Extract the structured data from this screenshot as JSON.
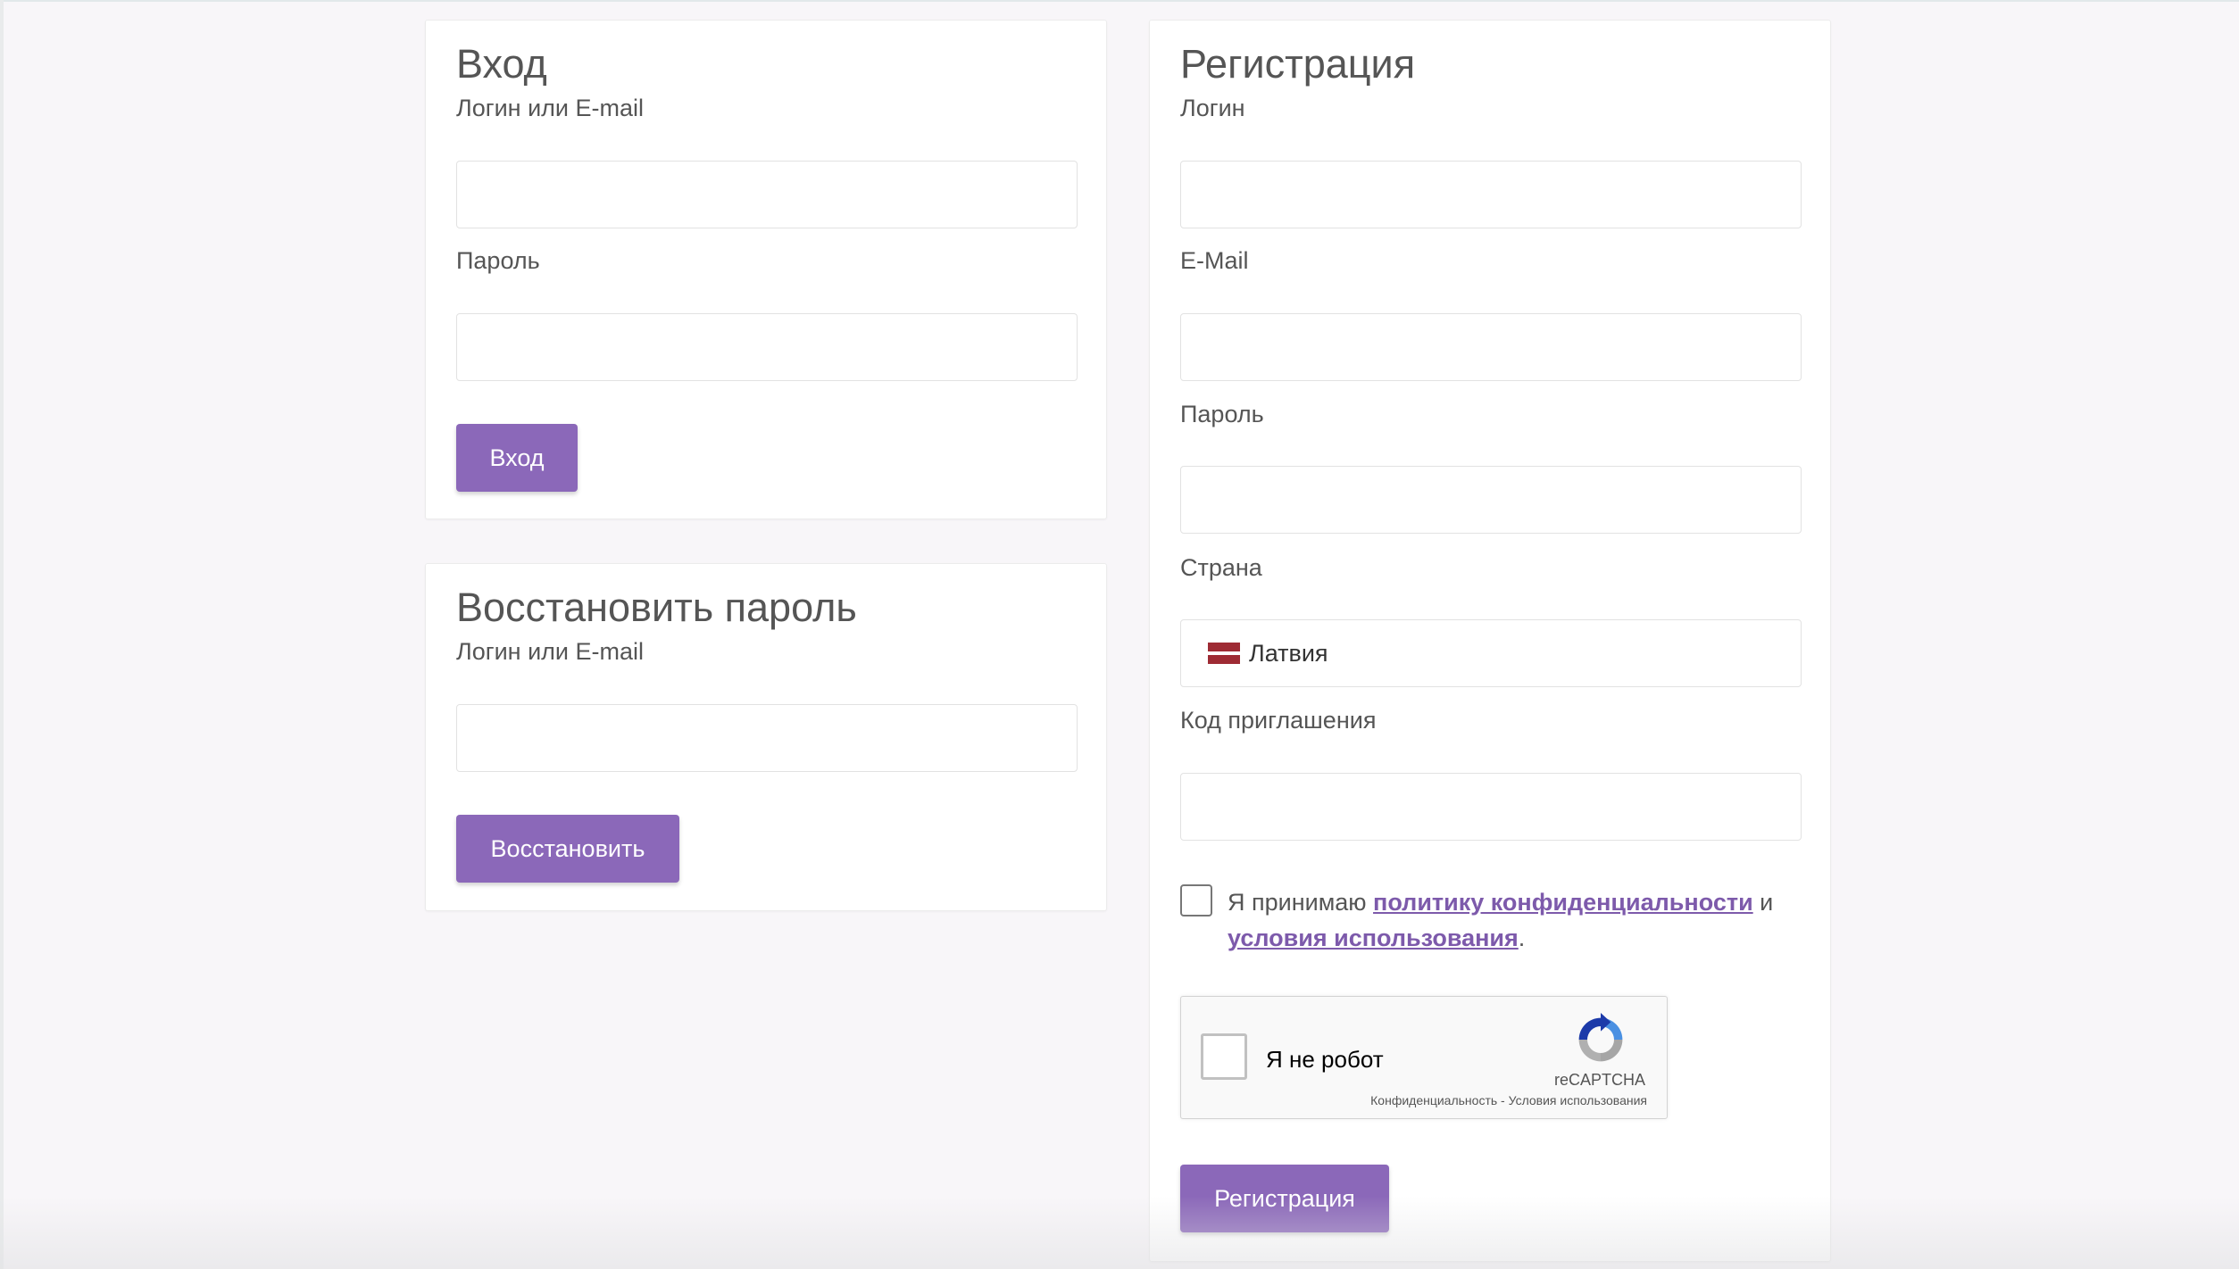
{
  "login": {
    "title": "Вход",
    "login_label": "Логин или E-mail",
    "login_value": "",
    "password_label": "Пароль",
    "password_value": "",
    "button": "Вход"
  },
  "recover": {
    "title": "Восстановить пароль",
    "login_label": "Логин или E-mail",
    "login_value": "",
    "button": "Восстановить"
  },
  "register": {
    "title": "Регистрация",
    "login_label": "Логин",
    "login_value": "",
    "email_label": "E-Mail",
    "email_value": "",
    "password_label": "Пароль",
    "password_value": "",
    "country_label": "Страна",
    "country_value": "Латвия",
    "country_flag_icon": "latvia-flag-icon",
    "invite_label": "Код приглашения",
    "invite_value": "",
    "agree": {
      "prefix": "Я принимаю ",
      "privacy_link": "политику конфиденциальности",
      "middle": " и ",
      "terms_link": "условия использования",
      "suffix": ".",
      "checked": false
    },
    "recaptcha": {
      "label": "Я не робот",
      "brand": "reCAPTCHA",
      "privacy": "Конфиденциальность",
      "separator": " - ",
      "terms": "Условия использования"
    },
    "button": "Регистрация"
  },
  "colors": {
    "accent": "#8b68b9",
    "link": "#7d5aab",
    "background": "#f8f6f9",
    "flag_red": "#9e2b34"
  }
}
